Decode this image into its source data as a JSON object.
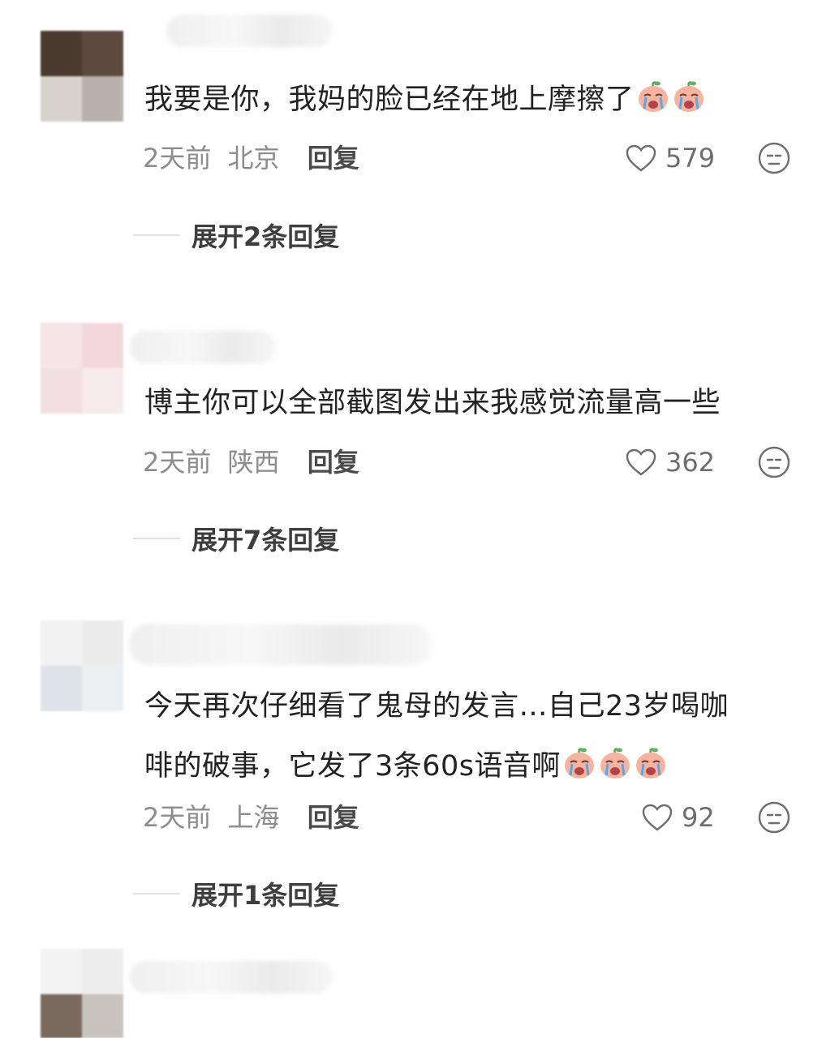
{
  "comments": [
    {
      "text": "我要是你，我妈的脸已经在地上摩擦了",
      "emojis": [
        "crying-face-emoji",
        "crying-face-emoji"
      ],
      "time": "2天前",
      "location": "北京",
      "reply_label": "回复",
      "likes": "579",
      "expand_label": "展开2条回复"
    },
    {
      "text": "博主你可以全部截图发出来我感觉流量高一些",
      "emojis": [],
      "time": "2天前",
      "location": "陕西",
      "reply_label": "回复",
      "likes": "362",
      "expand_label": "展开7条回复"
    },
    {
      "text_line1": "今天再次仔细看了鬼母的发言…自己23岁喝咖",
      "text_line2": "啡的破事，它发了3条60s语音啊",
      "emojis": [
        "crying-face-emoji",
        "crying-face-emoji",
        "crying-face-emoji"
      ],
      "time": "2天前",
      "location": "上海",
      "reply_label": "回复",
      "likes": "92",
      "expand_label": "展开1条回复"
    }
  ],
  "icons": {
    "like": "heart-outline-icon",
    "dislike": "neutral-face-icon"
  },
  "colors": {
    "text": "#222222",
    "meta": "#8c8c8c",
    "reply": "#4a4a4a"
  }
}
